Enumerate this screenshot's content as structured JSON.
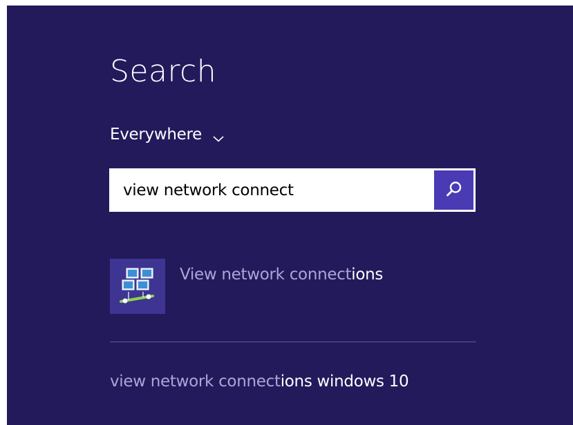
{
  "panel": {
    "title": "Search",
    "background_color": "#231a5c",
    "accent_color": "#4a3bb4"
  },
  "scope": {
    "selected": "Everywhere",
    "icon": "chevron-down-icon"
  },
  "search": {
    "value": "view network connect",
    "button_icon": "search-icon"
  },
  "results": [
    {
      "icon": "network-connections-icon",
      "label_match": "View network connect",
      "label_rest": "ions"
    }
  ],
  "suggestions": [
    {
      "label_match": "view network connect",
      "label_rest": "ions windows 10"
    }
  ]
}
